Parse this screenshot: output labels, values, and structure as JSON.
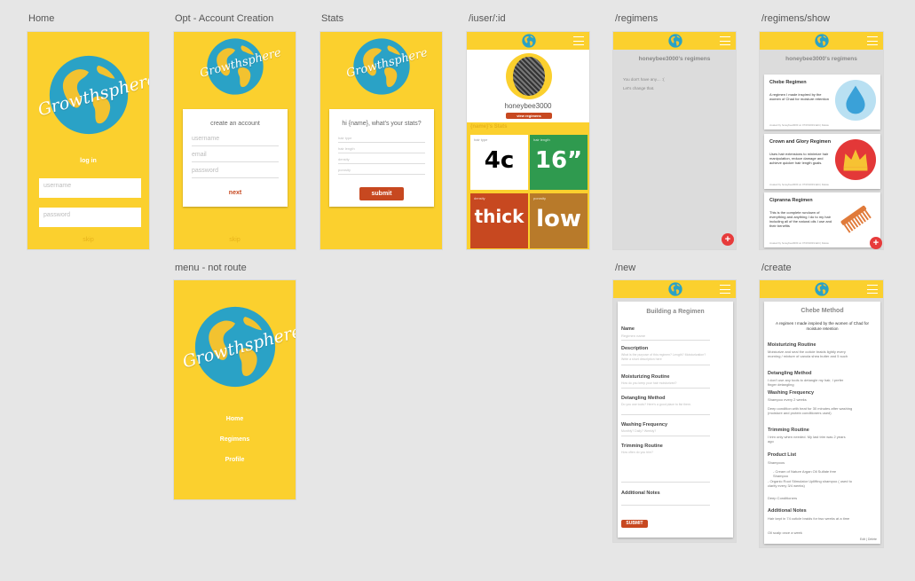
{
  "labels": {
    "home": "Home",
    "opt": "Opt - Account Creation",
    "stats": "Stats",
    "iuser": "/iuser/:id",
    "regimens": "/regimens",
    "show": "/regimens/show",
    "menu": "menu - not route",
    "new": "/new",
    "create": "/create"
  },
  "brand": {
    "name": "Growthsphere"
  },
  "home": {
    "login": "log in",
    "username_ph": "username",
    "password_ph": "password",
    "skip": "skip"
  },
  "account": {
    "heading": "create an account",
    "username": "username",
    "email": "email",
    "password": "password",
    "next": "next",
    "skip": "skip"
  },
  "stats": {
    "heading": "hi {name}, what's your stats?",
    "f1": "hair type",
    "f2": "hair length",
    "f3": "density",
    "f4": "porosity",
    "submit": "submit"
  },
  "profile": {
    "username": "honeybee3000",
    "view": "view regimens",
    "stats_title": "{name}'s Stats",
    "tiles": [
      {
        "label": "hair type",
        "value": "4c",
        "color": "#ffffff",
        "text": "#000000"
      },
      {
        "label": "hair length",
        "value": "16”",
        "color": "#2f9a4f",
        "text": "#ffffff"
      },
      {
        "label": "density",
        "value": "thick",
        "color": "#c74820",
        "text": "#ffffff"
      },
      {
        "label": "porosity",
        "value": "low",
        "color": "#b87a2a",
        "text": "#ffffff"
      }
    ]
  },
  "regimens": {
    "title": "honeybee3000's regimens",
    "empty1": "You don't have any.... :(",
    "empty2": "Let's change that."
  },
  "show": {
    "title": "honeybee3000's regimens",
    "cards": [
      {
        "title": "Chebe Regimen",
        "desc": "A regimen I made inspired by the women of Chad for moisture retention",
        "meta": "created by honeybee3000 on 07/15/2019 Edit | Delete",
        "icon": "water-drop-icon"
      },
      {
        "title": "Crown and Glory Regimen",
        "desc": "Uses hair extensions to minimize hair manipulation, reduce damage and achieve quicker hair length goals.",
        "meta": "created by honeybee3000 on 07/15/2019 Edit | Delete",
        "icon": "crown-icon"
      },
      {
        "title": "Cipranna Regimen",
        "desc": "This is the complete rundown of everything and anything I do to my hair including all of the natural oils I use and their benefits",
        "meta": "created by honeybee3000 on 07/15/2019 Edit | Delete",
        "icon": "comb-icon"
      }
    ]
  },
  "menu": {
    "items": [
      "Home",
      "Regimens",
      "Profile"
    ]
  },
  "newform": {
    "title": "Building a Regimen",
    "name": "Name",
    "name_ph": "Regimen name",
    "desc": "Description",
    "desc_ph": "What is the purpose of this regimen? Length? Moisturization? Write a short description here",
    "moist": "Moisturizing Routine",
    "moist_ph": "How do you keep your hair moisturized?",
    "detangle": "Detangling Method",
    "detangle_ph": "Do you use tools? Here's a good place to list them.",
    "wash": "Washing Frequency",
    "wash_ph": "Monthly? Daily? Weekly?",
    "trim": "Trimming Routine",
    "trim_ph": "How often do you trim?",
    "notes": "Additional Notes",
    "submit": "SUBMIT"
  },
  "create": {
    "title": "Chebe Method",
    "subtitle": "A regimen I made inspired by the women of Chad for moisture retention",
    "moist_h": "Moisturizing Routine",
    "moist_t": "Moisturize and seal the cuticle braids lightly every morning / mixture of canola shea butter and 5 such",
    "detangle_h": "Detangling Method",
    "detangle_t": "I don't use any tools to detangle my hair, I prefer finger detangling",
    "wash_h": "Washing Frequency",
    "wash_t": "Shampoo every 2 weeks",
    "wash_t2": "Deep condition with heat for 30 minutes after washing (moisture and protein conditioners used)",
    "trim_h": "Trimming Routine",
    "trim_t": "I trim only when needed. My last trim was 2 years ago",
    "products_h": "Product List",
    "shampoo": "Shampoos",
    "p1": "- Cream of Nature Argan Oil Sulfate free Shampoo",
    "p2": "- Organic Root Stimulator Uplifting shampoo ( used to clarify every 3/4 weeks)",
    "deep": "Deep Conditioners",
    "notes_h": "Additional Notes",
    "notes_t": "Hair kept in 74 cuticle braids for two weeks at a time",
    "notes_t2": "Oil scalp once a week",
    "actions": "Edit | Delete"
  }
}
